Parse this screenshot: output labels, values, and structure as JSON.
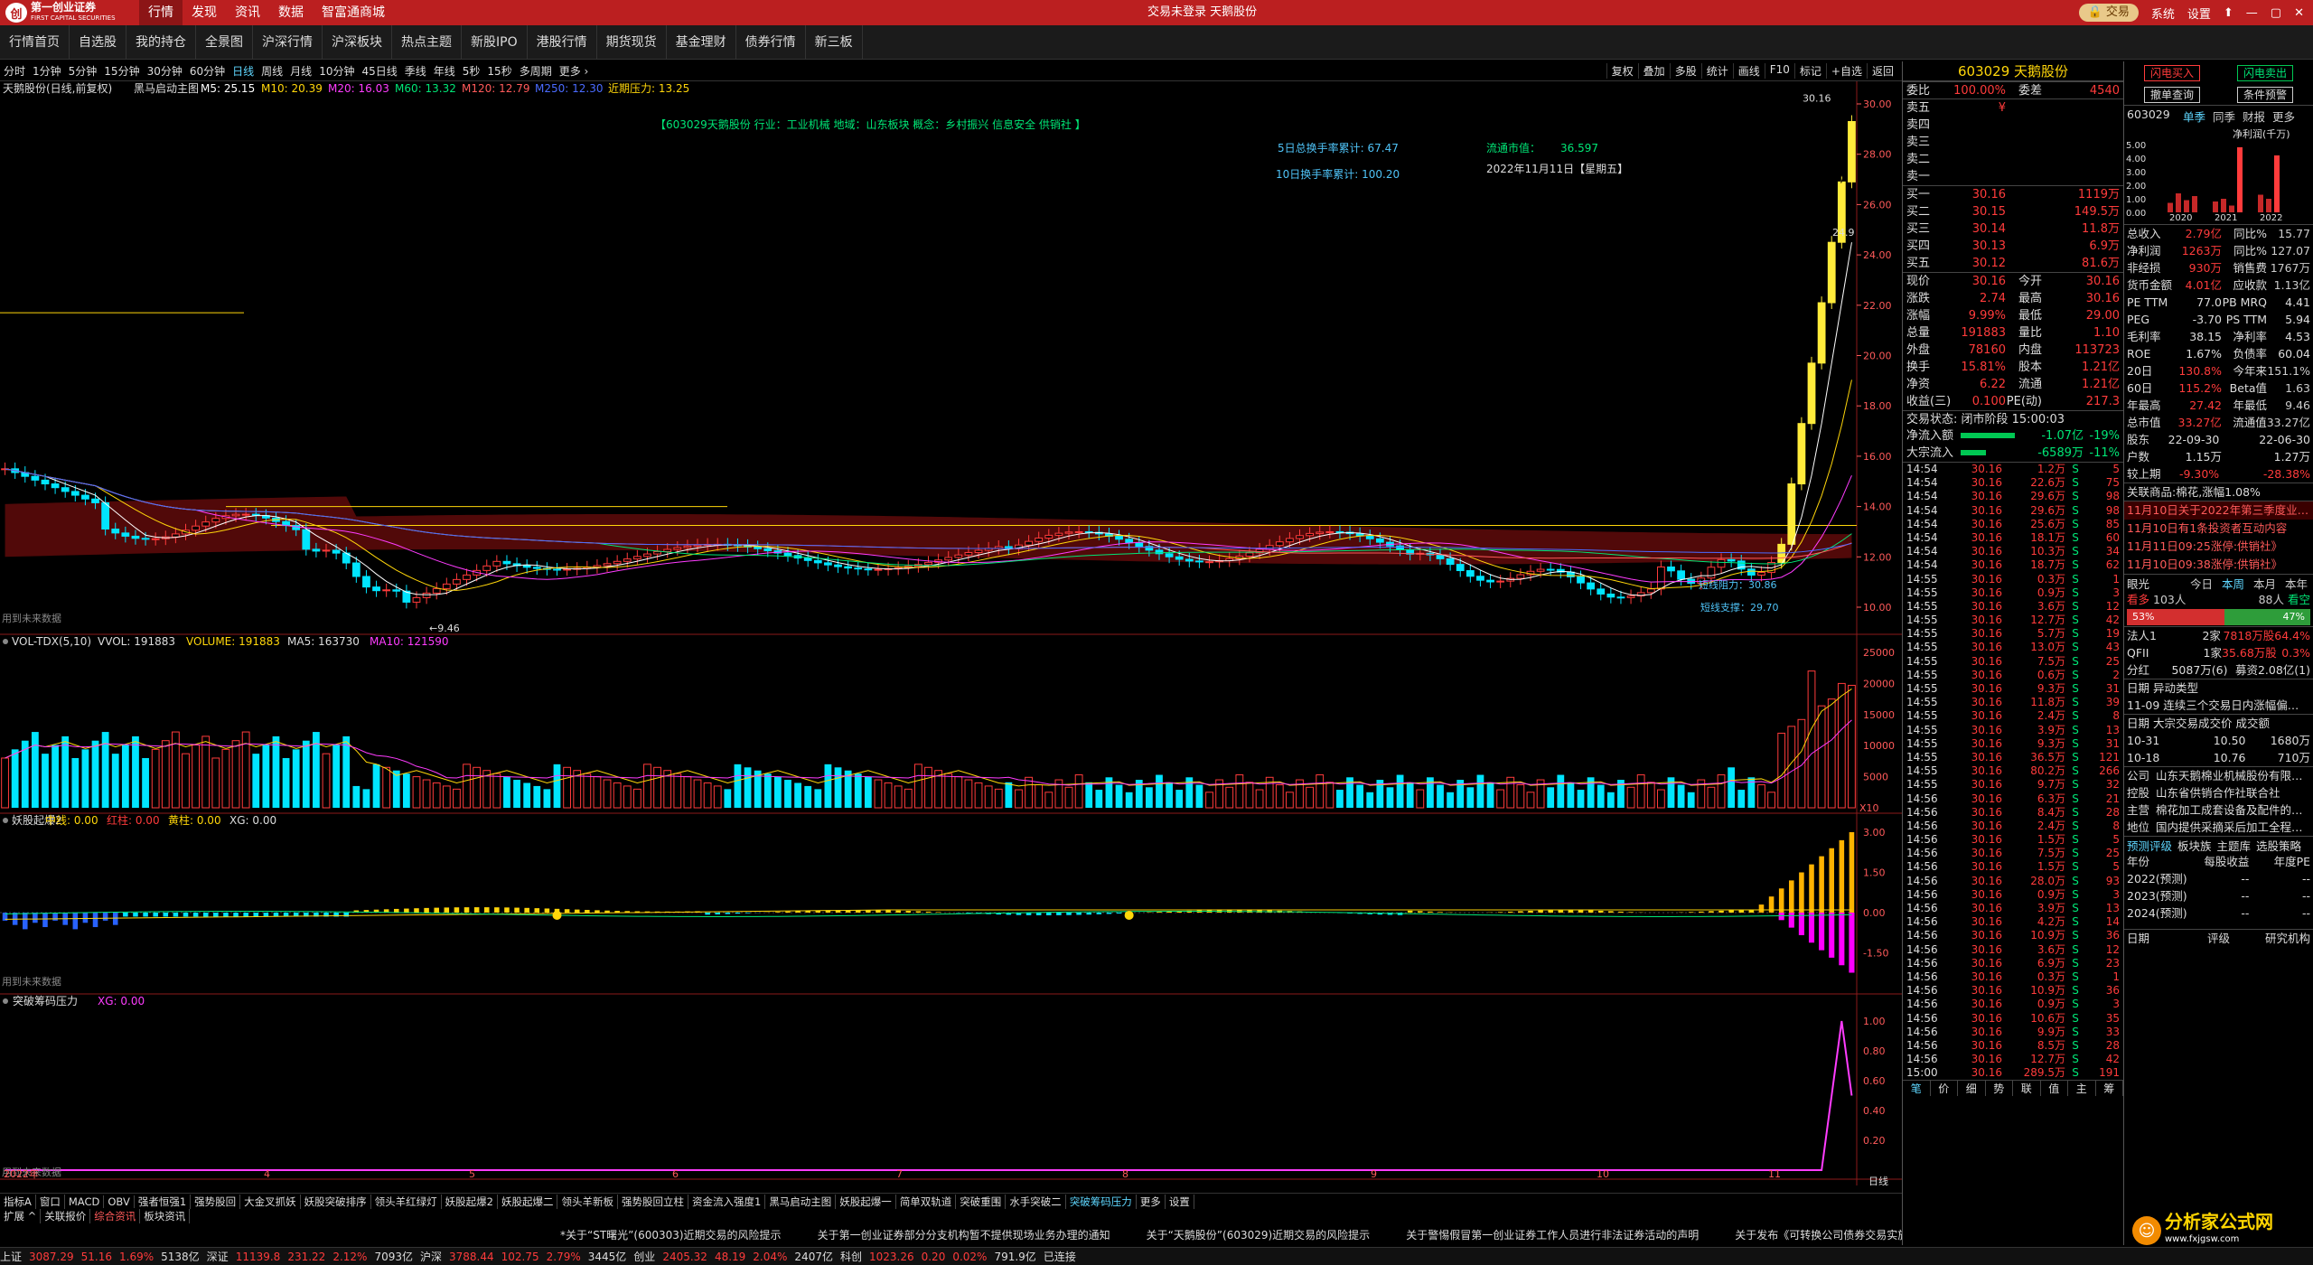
{
  "top": {
    "logo_text": "第一创业证券",
    "logo_sub": "FIRST CAPITAL SECURITIES",
    "menu": [
      "行情",
      "发现",
      "资讯",
      "数据",
      "智富通商城"
    ],
    "center": "交易未登录  天鹅股份",
    "trade_btn": "交易",
    "system": "系统",
    "settings": "设置"
  },
  "tabs": [
    "行情首页",
    "自选股",
    "我的持仓",
    "全景图",
    "沪深行情",
    "沪深板块",
    "热点主题",
    "新股IPO",
    "港股行情",
    "期货现货",
    "基金理财",
    "债券行情",
    "新三板"
  ],
  "periods": [
    "分时",
    "1分钟",
    "5分钟",
    "15分钟",
    "30分钟",
    "60分钟",
    "日线",
    "周线",
    "月线",
    "10分钟",
    "45日线",
    "季线",
    "年线",
    "5秒",
    "15秒",
    "多周期",
    "更多 ›"
  ],
  "period_active": "日线",
  "chart_tools": [
    "复权",
    "叠加",
    "多股",
    "统计",
    "画线",
    "F10",
    "标记",
    "+自选",
    "返回"
  ],
  "main": {
    "title": "天鹅股份(日线,前复权)",
    "indicator": "黑马启动主图",
    "ma": [
      {
        "t": "M5: 25.15",
        "c": "#ffffff"
      },
      {
        "t": "M10: 20.39",
        "c": "#ffd60a"
      },
      {
        "t": "M20: 16.03",
        "c": "#ff3cff"
      },
      {
        "t": "M60: 13.32",
        "c": "#00e676"
      },
      {
        "t": "M120: 12.79",
        "c": "#ff5a5a"
      },
      {
        "t": "M250: 12.30",
        "c": "#4a6bff"
      },
      {
        "t": "近期压力: 13.25",
        "c": "#ffd60a"
      }
    ],
    "info": "【603029天鹅股份  行业：工业机械  地域：山东板块  概念：乡村振兴 信息安全 供销社 】",
    "turn5": "5日总换手率累计: 67.47",
    "turn10": "10日换手率累计: 100.20",
    "float_label": "流通市值：",
    "float_val": "36.597",
    "date": "2022年11月11日【星期五】",
    "pressure": "短线阻力：30.86",
    "support": "短线支撑：29.70",
    "high_label": "30.16",
    "low_label": "9.46",
    "future": "用到未来数据",
    "mark_27": "27",
    "mark_249": "24.9",
    "ylabels": [
      "30.00",
      "28.00",
      "26.00",
      "24.00",
      "22.00",
      "20.00",
      "18.00",
      "16.00",
      "14.00",
      "12.00",
      "10.00"
    ]
  },
  "vol": {
    "title": "VOL-TDX(5,10)",
    "vvol": "VVOL: 191883",
    "volume": "VOLUME: 191883",
    "ma5": "MA5: 163730",
    "ma10": "MA10: 121590",
    "ylabels": [
      "25000",
      "20000",
      "15000",
      "10000",
      "5000"
    ],
    "x10": "X10"
  },
  "ind1": {
    "title": "妖股起爆2",
    "l1": "中线: 0.00",
    "l2": "红柱: 0.00",
    "l3": "黄柱: 0.00",
    "l4": "XG: 0.00",
    "ylabels": [
      "3.00",
      "1.50",
      "0.00",
      "-1.50"
    ],
    "future": "用到未来数据"
  },
  "ind2": {
    "title": "突破筹码压力",
    "l1": "XG: 0.00",
    "ylabels": [
      "1.00",
      "0.80",
      "0.60",
      "0.40",
      "0.20"
    ],
    "future": "用到未来数据"
  },
  "xlabels": [
    "2022年",
    "4",
    "5",
    "6",
    "7",
    "8",
    "9",
    "10",
    "11"
  ],
  "xlabel_end": "日线",
  "bottom_tabs": [
    "指标A",
    "窗口",
    "MACD",
    "OBV",
    "强者恒强1",
    "强势股回",
    "大金叉抓妖",
    "妖股突破排序",
    "领头羊红绿灯",
    "妖股起爆2",
    "妖股起爆二",
    "领头羊新板",
    "强势股回立柱",
    "资金流入强度1",
    "黑马启动主图",
    "妖股起爆一",
    "简单双轨道",
    "突破重围",
    "水手突破二",
    "突破筹码压力",
    "更多",
    "设置"
  ],
  "bottom_tabs_active": "突破筹码压力",
  "bottom_tabs2": [
    "扩展 ^",
    "关联报价",
    "综合资讯",
    "板块资讯"
  ],
  "right_small": [
    "指标B",
    "模",
    "板"
  ],
  "news": [
    "*关于“ST曙光”(600303)近期交易的风险提示",
    "关于第一创业证券部分分支机构暂不提供现场业务办理的通知",
    "关于“天鹅股份”(603029)近期交易的风险提示",
    "关于警惕假冒第一创业证券工作人员进行非法证券活动的声明",
    "关于发布《可转换公司债券交易实施细则》的通知"
  ],
  "status": [
    {
      "t": "上证",
      "c": "white"
    },
    {
      "t": "3087.29",
      "c": "red"
    },
    {
      "t": "51.16",
      "c": "red"
    },
    {
      "t": "1.69%",
      "c": "red"
    },
    {
      "t": "5138亿",
      "c": "white"
    },
    {
      "t": "深证",
      "c": "white"
    },
    {
      "t": "11139.8",
      "c": "red"
    },
    {
      "t": "231.22",
      "c": "red"
    },
    {
      "t": "2.12%",
      "c": "red"
    },
    {
      "t": "7093亿",
      "c": "white"
    },
    {
      "t": "沪深",
      "c": "white"
    },
    {
      "t": "3788.44",
      "c": "red"
    },
    {
      "t": "102.75",
      "c": "red"
    },
    {
      "t": "2.79%",
      "c": "red"
    },
    {
      "t": "3445亿",
      "c": "white"
    },
    {
      "t": "创业",
      "c": "white"
    },
    {
      "t": "2405.32",
      "c": "red"
    },
    {
      "t": "48.19",
      "c": "red"
    },
    {
      "t": "2.04%",
      "c": "red"
    },
    {
      "t": "2407亿",
      "c": "white"
    },
    {
      "t": "科创",
      "c": "white"
    },
    {
      "t": "1023.26",
      "c": "red"
    },
    {
      "t": "0.20",
      "c": "red"
    },
    {
      "t": "0.02%",
      "c": "red"
    },
    {
      "t": "791.9亿",
      "c": "white"
    },
    {
      "t": "已连接",
      "c": "white"
    }
  ],
  "quote": {
    "title": "603029 天鹅股份",
    "weibi_label": "委比",
    "weibi": "100.00%",
    "weicha_label": "委差",
    "weicha": "4540",
    "sells": [
      {
        "l": "卖五",
        "p": "¥",
        "v": ""
      },
      {
        "l": "卖四",
        "p": "",
        "v": ""
      },
      {
        "l": "卖三",
        "p": "",
        "v": ""
      },
      {
        "l": "卖二",
        "p": "",
        "v": ""
      },
      {
        "l": "卖一",
        "p": "",
        "v": ""
      }
    ],
    "buys": [
      {
        "l": "买一",
        "p": "30.16",
        "v": "1119万"
      },
      {
        "l": "买二",
        "p": "30.15",
        "v": "149.5万"
      },
      {
        "l": "买三",
        "p": "30.14",
        "v": "11.8万"
      },
      {
        "l": "买四",
        "p": "30.13",
        "v": "6.9万"
      },
      {
        "l": "买五",
        "p": "30.12",
        "v": "81.6万"
      }
    ],
    "stats": [
      [
        "现价",
        "30.16",
        "今开",
        "30.16"
      ],
      [
        "涨跌",
        "2.74",
        "最高",
        "30.16"
      ],
      [
        "涨幅",
        "9.99%",
        "最低",
        "29.00"
      ],
      [
        "总量",
        "191883",
        "量比",
        "1.10"
      ],
      [
        "外盘",
        "78160",
        "内盘",
        "113723"
      ],
      [
        "换手",
        "15.81%",
        "股本",
        "1.21亿"
      ],
      [
        "净资",
        "6.22",
        "流通",
        "1.21亿"
      ],
      [
        "收益(三)",
        "0.100",
        "PE(动)",
        "217.3"
      ]
    ],
    "status_line": "交易状态: 闭市阶段 15:00:03",
    "inflow_label": "净流入额",
    "inflow_val": "-1.07亿",
    "inflow_pct": "-19%",
    "big_label": "大宗流入",
    "big_val": "-6589万",
    "big_pct": "-11%",
    "ticks": [
      [
        "14:54",
        "30.16",
        "1.2万",
        "S",
        "5"
      ],
      [
        "14:54",
        "30.16",
        "22.6万",
        "S",
        "75"
      ],
      [
        "14:54",
        "30.16",
        "29.6万",
        "S",
        "98"
      ],
      [
        "14:54",
        "30.16",
        "29.6万",
        "S",
        "98"
      ],
      [
        "14:54",
        "30.16",
        "25.6万",
        "S",
        "85"
      ],
      [
        "14:54",
        "30.16",
        "18.1万",
        "S",
        "60"
      ],
      [
        "14:54",
        "30.16",
        "10.3万",
        "S",
        "34"
      ],
      [
        "14:54",
        "30.16",
        "18.7万",
        "S",
        "62"
      ],
      [
        "14:55",
        "30.16",
        "0.3万",
        "S",
        "1"
      ],
      [
        "14:55",
        "30.16",
        "0.9万",
        "S",
        "3"
      ],
      [
        "14:55",
        "30.16",
        "3.6万",
        "S",
        "12"
      ],
      [
        "14:55",
        "30.16",
        "12.7万",
        "S",
        "42"
      ],
      [
        "14:55",
        "30.16",
        "5.7万",
        "S",
        "19"
      ],
      [
        "14:55",
        "30.16",
        "13.0万",
        "S",
        "43"
      ],
      [
        "14:55",
        "30.16",
        "7.5万",
        "S",
        "25"
      ],
      [
        "14:55",
        "30.16",
        "0.6万",
        "S",
        "2"
      ],
      [
        "14:55",
        "30.16",
        "9.3万",
        "S",
        "31"
      ],
      [
        "14:55",
        "30.16",
        "11.8万",
        "S",
        "39"
      ],
      [
        "14:55",
        "30.16",
        "2.4万",
        "S",
        "8"
      ],
      [
        "14:55",
        "30.16",
        "3.9万",
        "S",
        "13"
      ],
      [
        "14:55",
        "30.16",
        "9.3万",
        "S",
        "31"
      ],
      [
        "14:55",
        "30.16",
        "36.5万",
        "S",
        "121"
      ],
      [
        "14:55",
        "30.16",
        "80.2万",
        "S",
        "266"
      ],
      [
        "14:55",
        "30.16",
        "9.7万",
        "S",
        "32"
      ],
      [
        "14:56",
        "30.16",
        "6.3万",
        "S",
        "21"
      ],
      [
        "14:56",
        "30.16",
        "8.4万",
        "S",
        "28"
      ],
      [
        "14:56",
        "30.16",
        "2.4万",
        "S",
        "8"
      ],
      [
        "14:56",
        "30.16",
        "1.5万",
        "S",
        "5"
      ],
      [
        "14:56",
        "30.16",
        "7.5万",
        "S",
        "25"
      ],
      [
        "14:56",
        "30.16",
        "1.5万",
        "S",
        "5"
      ],
      [
        "14:56",
        "30.16",
        "28.0万",
        "S",
        "93"
      ],
      [
        "14:56",
        "30.16",
        "0.9万",
        "S",
        "3"
      ],
      [
        "14:56",
        "30.16",
        "3.9万",
        "S",
        "13"
      ],
      [
        "14:56",
        "30.16",
        "4.2万",
        "S",
        "14"
      ],
      [
        "14:56",
        "30.16",
        "10.9万",
        "S",
        "36"
      ],
      [
        "14:56",
        "30.16",
        "3.6万",
        "S",
        "12"
      ],
      [
        "14:56",
        "30.16",
        "6.9万",
        "S",
        "23"
      ],
      [
        "14:56",
        "30.16",
        "0.3万",
        "S",
        "1"
      ],
      [
        "14:56",
        "30.16",
        "10.9万",
        "S",
        "36"
      ],
      [
        "14:56",
        "30.16",
        "0.9万",
        "S",
        "3"
      ],
      [
        "14:56",
        "30.16",
        "10.6万",
        "S",
        "35"
      ],
      [
        "14:56",
        "30.16",
        "9.9万",
        "S",
        "33"
      ],
      [
        "14:56",
        "30.16",
        "8.5万",
        "S",
        "28"
      ],
      [
        "14:56",
        "30.16",
        "12.7万",
        "S",
        "42"
      ],
      [
        "15:00",
        "30.16",
        "289.5万",
        "S",
        "191"
      ]
    ],
    "tabs": [
      "笔",
      "价",
      "细",
      "势",
      "联",
      "值",
      "主",
      "筹"
    ]
  },
  "f10": {
    "btn_buy": "闪电买入",
    "btn_sell": "闪电卖出",
    "btn_cancel": "撤单查询",
    "btn_cond": "条件预警",
    "code": "603029",
    "tabs": [
      "单季",
      "同季",
      "财报",
      "更多"
    ],
    "chart_title": "净利润(千万)",
    "chart_years": [
      "2020",
      "2021",
      "2022"
    ],
    "chart_y": [
      "5.00",
      "4.00",
      "3.00",
      "2.00",
      "1.00",
      "0.00"
    ],
    "rows": [
      [
        "总收入",
        "2.79亿",
        "同比%",
        "15.77"
      ],
      [
        "净利润",
        "1263万",
        "同比%",
        "127.07"
      ],
      [
        "非经损",
        "930万",
        "销售费",
        "1767万"
      ],
      [
        "货币金额",
        "4.01亿",
        "应收款",
        "1.13亿"
      ],
      [
        "PE TTM",
        "77.0",
        "PB MRQ",
        "4.41"
      ],
      [
        "PEG",
        "-3.70",
        "PS TTM",
        "5.94"
      ],
      [
        "毛利率",
        "38.15",
        "净利率",
        "4.53"
      ],
      [
        "ROE",
        "1.67%",
        "负债率",
        "60.04"
      ],
      [
        "20日",
        "130.8%",
        "今年来",
        "151.1%"
      ],
      [
        "60日",
        "115.2%",
        "Beta值",
        "1.63"
      ],
      [
        "年最高",
        "27.42",
        "年最低",
        "9.46"
      ],
      [
        "总市值",
        "33.27亿",
        "流通值",
        "33.27亿"
      ],
      [
        "股东",
        "22-09-30",
        "",
        "22-06-30"
      ],
      [
        "户数",
        "1.15万",
        "",
        "1.27万"
      ],
      [
        "较上期",
        "-9.30%",
        "",
        "-28.38%"
      ]
    ],
    "related": "关联商品:棉花,涨幅1.08%",
    "news": [
      "11月10日关于2022年第三季度业…",
      "11月10日有1条投资者互动内容",
      "11月11日09:25涨停:供销社》",
      "11月10日09:38涨停:供销社》"
    ],
    "eye_label": "眼光",
    "eye_tabs": [
      "今日",
      "本周",
      "本月",
      "本年"
    ],
    "bull": "看多",
    "bull_n": "103人",
    "bear_n": "88人",
    "bear": "看空",
    "bull_pct": "53%",
    "bear_pct": "47%",
    "inst": [
      [
        "法人1",
        "2家",
        "7818万股",
        "64.4%"
      ],
      [
        "QFII",
        "1家",
        "35.68万股",
        "0.3%"
      ]
    ],
    "div": [
      "分红",
      "5087万(6)",
      "募资",
      "2.08亿(1)"
    ],
    "abn_head": "日期      异动类型",
    "abn": [
      "11-09  连续三个交易日内涨幅偏…"
    ],
    "big_head": "日期       大宗交易成交价       成交额",
    "big": [
      [
        "10-31",
        "10.50",
        "1680万"
      ],
      [
        "10-18",
        "10.76",
        "710万"
      ]
    ],
    "company": [
      [
        "公司",
        "山东天鹅棉业机械股份有限…"
      ],
      [
        "控股",
        "山东省供销合作社联合社"
      ],
      [
        "主营",
        "棉花加工成套设备及配件的…"
      ],
      [
        "地位",
        "国内提供采摘采后加工全程…"
      ]
    ],
    "fc_tabs": [
      "预测评级",
      "板块族",
      "主题库",
      "选股策略"
    ],
    "fc_head": [
      "年份",
      "每股收益",
      "年度PE"
    ],
    "fc": [
      "2022(预测)",
      "2023(预测)",
      "2024(预测)"
    ],
    "rating_head": [
      "日期",
      "评级",
      "研究机构"
    ]
  },
  "watermark": {
    "t": "分析家公式网",
    "s": "www.fxjgsw.com"
  },
  "chart_data": {
    "type": "candlestick",
    "title": "天鹅股份(日线,前复权)",
    "ylim": [
      9,
      31
    ],
    "last_close": 30.16,
    "high": 30.16,
    "low": 9.46,
    "period_end": "2022-11-11"
  }
}
